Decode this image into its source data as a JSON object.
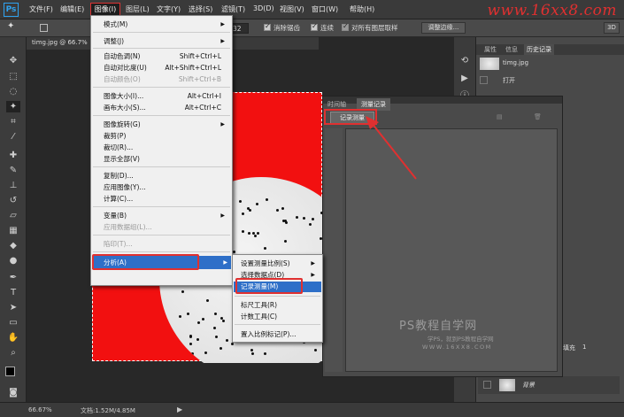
{
  "app": {
    "logo": "Ps"
  },
  "menubar": {
    "items": [
      "文件(F)",
      "编辑(E)",
      "图像(I)",
      "图层(L)",
      "文字(Y)",
      "选择(S)",
      "滤镜(T)",
      "3D(D)",
      "视图(V)",
      "窗口(W)",
      "帮助(H)"
    ],
    "watermark": "www.16xx8.com"
  },
  "optionbar": {
    "value": "32",
    "antialias": "消除锯齿",
    "contiguous": "连续",
    "all_layers": "对所有图层取样",
    "refine": "调整边缘...",
    "mode_3d": "3D"
  },
  "document": {
    "tab": "timg.jpg @ 66.7%"
  },
  "image_menu": {
    "items": [
      {
        "label": "模式(M)",
        "shortcut": "",
        "sub": true,
        "disabled": false
      },
      {
        "label": "调整(J)",
        "shortcut": "",
        "sub": true,
        "disabled": false
      },
      {
        "label": "自动色调(N)",
        "shortcut": "Shift+Ctrl+L",
        "sub": false,
        "disabled": false
      },
      {
        "label": "自动对比度(U)",
        "shortcut": "Alt+Shift+Ctrl+L",
        "sub": false,
        "disabled": false
      },
      {
        "label": "自动颜色(O)",
        "shortcut": "Shift+Ctrl+B",
        "sub": false,
        "disabled": true
      },
      {
        "label": "图像大小(I)...",
        "shortcut": "Alt+Ctrl+I",
        "sub": false,
        "disabled": false
      },
      {
        "label": "画布大小(S)...",
        "shortcut": "Alt+Ctrl+C",
        "sub": false,
        "disabled": false
      },
      {
        "label": "图像旋转(G)",
        "shortcut": "",
        "sub": true,
        "disabled": false
      },
      {
        "label": "裁剪(P)",
        "shortcut": "",
        "sub": false,
        "disabled": false
      },
      {
        "label": "裁切(R)...",
        "shortcut": "",
        "sub": false,
        "disabled": false
      },
      {
        "label": "显示全部(V)",
        "shortcut": "",
        "sub": false,
        "disabled": false
      },
      {
        "label": "复制(D)...",
        "shortcut": "",
        "sub": false,
        "disabled": false
      },
      {
        "label": "应用图像(Y)...",
        "shortcut": "",
        "sub": false,
        "disabled": false
      },
      {
        "label": "计算(C)...",
        "shortcut": "",
        "sub": false,
        "disabled": false
      },
      {
        "label": "变量(B)",
        "shortcut": "",
        "sub": true,
        "disabled": false
      },
      {
        "label": "应用数据组(L)...",
        "shortcut": "",
        "sub": false,
        "disabled": true
      },
      {
        "label": "陷印(T)...",
        "shortcut": "",
        "sub": false,
        "disabled": true
      },
      {
        "label": "分析(A)",
        "shortcut": "",
        "sub": true,
        "disabled": false
      }
    ]
  },
  "analysis_menu": {
    "items": [
      "设置测量比例(S)",
      "选择数据点(D)",
      "记录测量(M)",
      "标尺工具(R)",
      "计数工具(C)",
      "置入比例标记(P)..."
    ]
  },
  "measure_panel": {
    "tabs": [
      "时间轴",
      "测量记录"
    ],
    "record_button": "记录测量",
    "watermark_title": "PS教程自学网",
    "watermark_sub": "学PS，就到PS教程自学网",
    "watermark_url": "WWW.16XX8.COM"
  },
  "right_panel": {
    "tabs": [
      "属性",
      "信息",
      "历史记录"
    ],
    "history": [
      "timg.jpg",
      "打开"
    ],
    "fill_label": "填充",
    "fill_value": "1",
    "layer_name": "背景"
  },
  "status": {
    "zoom": "66.67%",
    "doc": "文档:1.52M/4.85M"
  },
  "colors": {
    "accent": "#2e6fc8",
    "highlight": "#e03030",
    "canvas": "#f21010"
  }
}
